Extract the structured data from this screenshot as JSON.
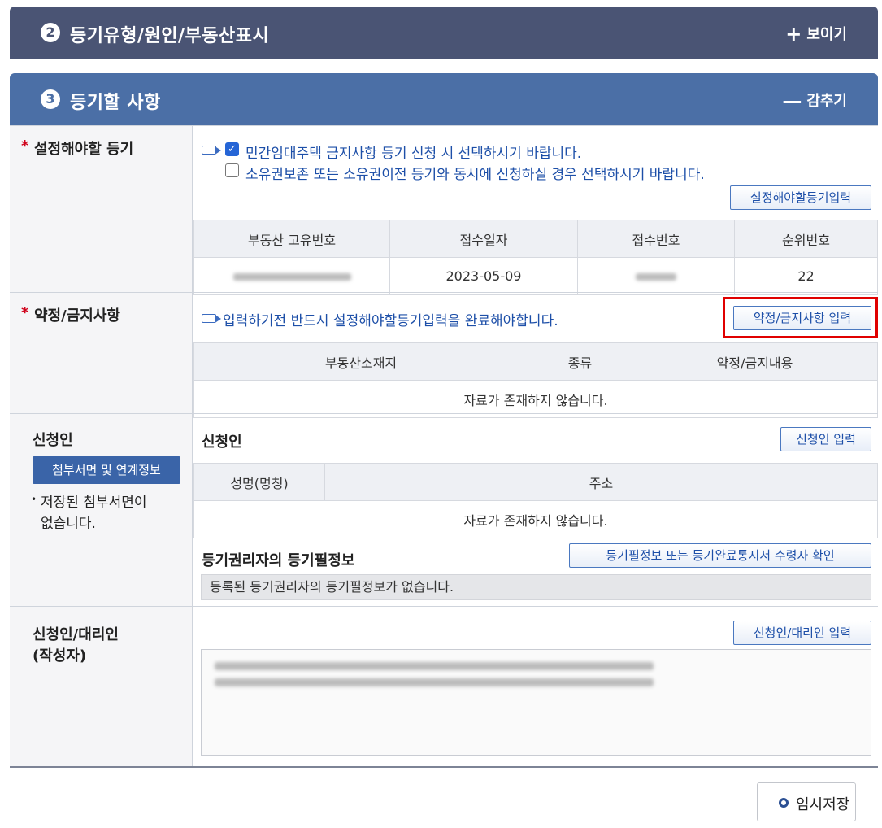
{
  "section2": {
    "number": "2",
    "title": "등기유형/원인/부동산표시",
    "toggle_symbol": "+",
    "toggle_label": "보이기"
  },
  "section3": {
    "number": "3",
    "title": "등기할 사항",
    "toggle_symbol": "—",
    "toggle_label": "감추기"
  },
  "required_mark": "*",
  "registration": {
    "label": "설정해야할 등기",
    "check1_label": "민간임대주택 금지사항 등기 신청 시 선택하시기 바랍니다.",
    "check1_checked": true,
    "check2_label": "소유권보존 또는 소유권이전 등기와 동시에 신청하실 경우 선택하시기 바랍니다.",
    "check2_checked": false,
    "input_button": "설정해야할등기입력",
    "table": {
      "headers": [
        "부동산 고유번호",
        "접수일자",
        "접수번호",
        "순위번호"
      ],
      "row": {
        "date": "2023-05-09",
        "rank": "22"
      }
    }
  },
  "restriction": {
    "label": "약정/금지사항",
    "notice": "입력하기전 반드시 설정해야할등기입력을 완료해야합니다.",
    "input_button": "약정/금지사항 입력",
    "table": {
      "headers": [
        "부동산소재지",
        "종류",
        "약정/금지내용"
      ],
      "empty": "자료가 존재하지 않습니다."
    }
  },
  "applicant": {
    "label": "신청인",
    "attach_button": "첨부서면 및 연계정보",
    "note_bullet": "•",
    "note": "저장된 첨부서면이 없습니다.",
    "sub_title": "신청인",
    "input_button": "신청인 입력",
    "table": {
      "headers": [
        "성명(명칭)",
        "주소"
      ],
      "empty": "자료가 존재하지 않습니다."
    },
    "rights_title": "등기권리자의 등기필정보",
    "rights_button": "등기필정보 또는 등기완료통지서 수령자 확인",
    "rights_empty": "등록된 등기권리자의 등기필정보가 없습니다."
  },
  "agent": {
    "label_line1": "신청인/대리인",
    "label_line2": "(작성자)",
    "input_button": "신청인/대리인 입력"
  },
  "save_button": "임시저장",
  "colors": {
    "section2_bar": "#4a5474",
    "section3_bar": "#4b6fa6",
    "required": "#d0021b",
    "link_blue": "#1d4fa8",
    "highlight": "#e00000"
  }
}
